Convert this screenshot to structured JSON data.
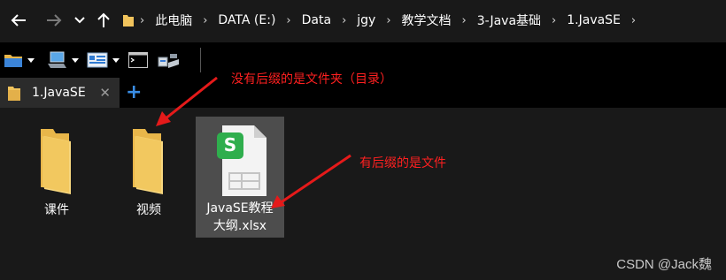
{
  "address_bar": {
    "crumbs": [
      "此电脑",
      "DATA (E:)",
      "Data",
      "jgy",
      "教学文档",
      "3-Java基础",
      "1.JavaSE"
    ],
    "separator": "›"
  },
  "quick_toolbar": {
    "items": [
      "folder-icon",
      "computer-icon",
      "control-panel-icon",
      "terminal-icon",
      "network-icon"
    ]
  },
  "tabs": [
    {
      "label": "1.JavaSE",
      "close": "✕"
    }
  ],
  "tab_add": "+",
  "files": [
    {
      "name": "课件",
      "type": "folder"
    },
    {
      "name": "视频",
      "type": "folder"
    },
    {
      "name_line1": "JavaSE教程",
      "name_line2": "大纲.xlsx",
      "type": "xlsx",
      "badge": "S"
    }
  ],
  "annotations": {
    "folder_note": "没有后缀的是文件夹（目录）",
    "file_note": "有后缀的是文件"
  },
  "watermark": "CSDN @Jack魏",
  "colors": {
    "background": "#191919",
    "toolbar": "#000000",
    "folder": "#f1c35c",
    "annotation": "#ff2020",
    "wps_green": "#2fae4d",
    "tab_add": "#3a8ee6"
  }
}
